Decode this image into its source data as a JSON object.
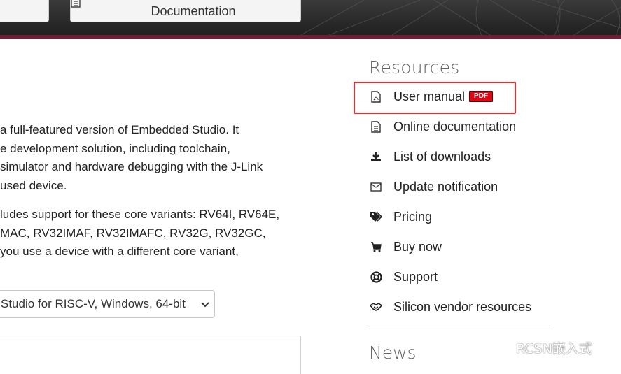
{
  "hero": {
    "documentation_label": "Documentation"
  },
  "description": {
    "paragraph1": [
      "a full-featured version of Embedded Studio. It",
      "e development solution, including toolchain,",
      " simulator and hardware debugging with the J-Link",
      "used device."
    ],
    "paragraph2": [
      "ludes support for these core variants: RV64I, RV64E,",
      "MAC, RV32IMAF, RV32IMAFC, RV32G, RV32GC,",
      " you use a device with a different core variant,"
    ]
  },
  "download_select": {
    "selected": "Studio for RISC-V, Windows, 64-bit"
  },
  "sidebar": {
    "resources_heading": "Resources",
    "news_heading": "News",
    "items": [
      {
        "label": "User manual",
        "icon": "pdf-file-icon",
        "badge": "PDF"
      },
      {
        "label": "Online documentation",
        "icon": "document-icon"
      },
      {
        "label": "List of downloads",
        "icon": "download-icon"
      },
      {
        "label": "Update notification",
        "icon": "envelope-icon"
      },
      {
        "label": "Pricing",
        "icon": "tags-icon"
      },
      {
        "label": "Buy now",
        "icon": "cart-icon"
      },
      {
        "label": "Support",
        "icon": "lifebuoy-icon"
      },
      {
        "label": "Silicon vendor resources",
        "icon": "handshake-icon"
      }
    ]
  },
  "watermark": {
    "text": "RCSN嵌入式",
    "icon": "wechat-icon"
  },
  "colors": {
    "highlight_border": "#e53030",
    "pdf_badge": "#e30613",
    "hero_stripe": "#6d1f36"
  }
}
